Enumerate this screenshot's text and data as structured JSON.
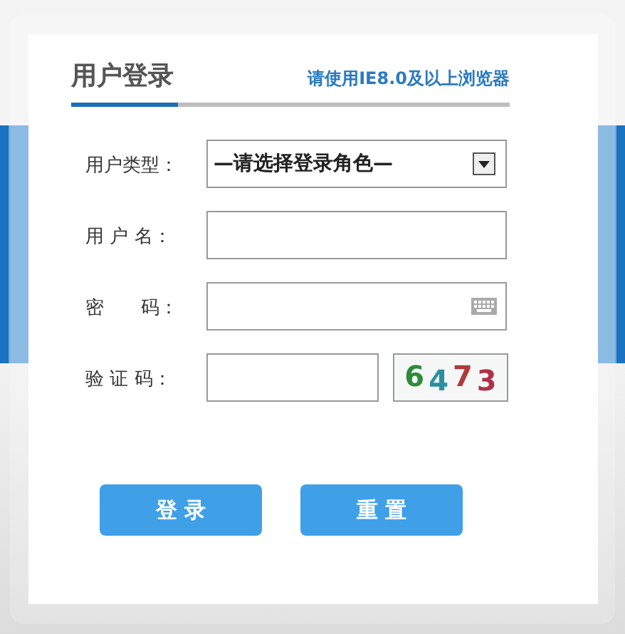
{
  "title": "用户登录",
  "browser_hint": "请使用IE8.0及以上浏览器",
  "fields": [
    {
      "kind": "select",
      "label": "用户类型：",
      "value": "—请选择登录角色—"
    },
    {
      "kind": "text",
      "label": "用 户 名："
    },
    {
      "kind": "password",
      "label": "密　　码："
    },
    {
      "kind": "captcha",
      "label": "验 证 码："
    }
  ],
  "captcha": [
    {
      "char": "6",
      "color": "#2e8b3a"
    },
    {
      "char": "4",
      "color": "#2a8fa0"
    },
    {
      "char": "7",
      "color": "#b03a3a"
    },
    {
      "char": "3",
      "color": "#b03048"
    }
  ],
  "buttons": [
    "登 录",
    "重 置"
  ]
}
